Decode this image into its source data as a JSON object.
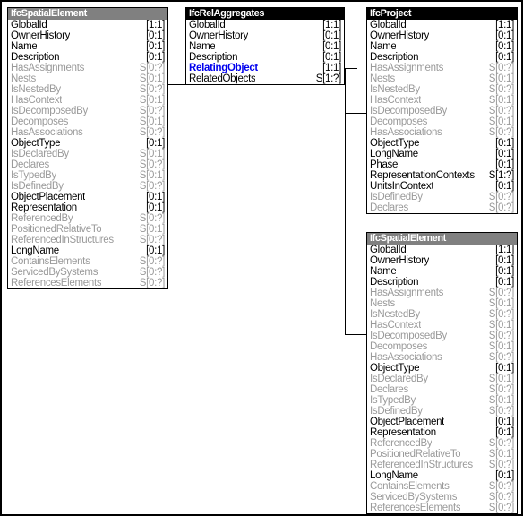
{
  "diagram": {
    "title": "IFC Entity Relationship Diagram",
    "background": "#ffffff",
    "border_color": "#000000",
    "colors": {
      "header_gray": "#808080",
      "header_black": "#000000",
      "direct_attribute": "#000000",
      "inverse_attribute": "#9a9a9a",
      "link_attribute": "#0000ee",
      "connector": "#000000"
    }
  },
  "entities": [
    {
      "id": "ifc-spatial-element-left",
      "name": "IfcSpatialElement",
      "header_style": "gray",
      "attributes": [
        {
          "name": "GlobalId",
          "cardinality": "[1:1]",
          "style": "direct"
        },
        {
          "name": "OwnerHistory",
          "cardinality": "[0:1]",
          "style": "direct"
        },
        {
          "name": "Name",
          "cardinality": "[0:1]",
          "style": "direct"
        },
        {
          "name": "Description",
          "cardinality": "[0:1]",
          "style": "direct"
        },
        {
          "name": "HasAssignments",
          "cardinality": "S[0:?]",
          "style": "inverse"
        },
        {
          "name": "Nests",
          "cardinality": "S[0:1]",
          "style": "inverse"
        },
        {
          "name": "IsNestedBy",
          "cardinality": "S[0:?]",
          "style": "inverse"
        },
        {
          "name": "HasContext",
          "cardinality": "S[0:1]",
          "style": "inverse"
        },
        {
          "name": "IsDecomposedBy",
          "cardinality": "S[0:?]",
          "style": "inverse"
        },
        {
          "name": "Decomposes",
          "cardinality": "S[0:1]",
          "style": "inverse"
        },
        {
          "name": "HasAssociations",
          "cardinality": "S[0:?]",
          "style": "inverse"
        },
        {
          "name": "ObjectType",
          "cardinality": "[0:1]",
          "style": "direct"
        },
        {
          "name": "IsDeclaredBy",
          "cardinality": "S[0:1]",
          "style": "inverse"
        },
        {
          "name": "Declares",
          "cardinality": "S[0:?]",
          "style": "inverse"
        },
        {
          "name": "IsTypedBy",
          "cardinality": "S[0:1]",
          "style": "inverse"
        },
        {
          "name": "IsDefinedBy",
          "cardinality": "S[0:?]",
          "style": "inverse"
        },
        {
          "name": "ObjectPlacement",
          "cardinality": "[0:1]",
          "style": "direct"
        },
        {
          "name": "Representation",
          "cardinality": "[0:1]",
          "style": "direct"
        },
        {
          "name": "ReferencedBy",
          "cardinality": "S[0:?]",
          "style": "inverse"
        },
        {
          "name": "PositionedRelativeTo",
          "cardinality": "S[0:1]",
          "style": "inverse"
        },
        {
          "name": "ReferencedInStructures",
          "cardinality": "S[0:?]",
          "style": "inverse"
        },
        {
          "name": "LongName",
          "cardinality": "[0:1]",
          "style": "direct"
        },
        {
          "name": "ContainsElements",
          "cardinality": "S[0:?]",
          "style": "inverse"
        },
        {
          "name": "ServicedBySystems",
          "cardinality": "S[0:?]",
          "style": "inverse"
        },
        {
          "name": "ReferencesElements",
          "cardinality": "S[0:?]",
          "style": "inverse"
        }
      ]
    },
    {
      "id": "ifc-rel-aggregates",
      "name": "IfcRelAggregates",
      "header_style": "black",
      "attributes": [
        {
          "name": "GlobalId",
          "cardinality": "[1:1]",
          "style": "direct"
        },
        {
          "name": "OwnerHistory",
          "cardinality": "[0:1]",
          "style": "direct"
        },
        {
          "name": "Name",
          "cardinality": "[0:1]",
          "style": "direct"
        },
        {
          "name": "Description",
          "cardinality": "[0:1]",
          "style": "direct"
        },
        {
          "name": "RelatingObject",
          "cardinality": "[1:1]",
          "style": "link"
        },
        {
          "name": "RelatedObjects",
          "cardinality": "S[1:?]",
          "style": "direct"
        }
      ]
    },
    {
      "id": "ifc-project",
      "name": "IfcProject",
      "header_style": "black",
      "attributes": [
        {
          "name": "GlobalId",
          "cardinality": "[1:1]",
          "style": "direct"
        },
        {
          "name": "OwnerHistory",
          "cardinality": "[0:1]",
          "style": "direct"
        },
        {
          "name": "Name",
          "cardinality": "[0:1]",
          "style": "direct"
        },
        {
          "name": "Description",
          "cardinality": "[0:1]",
          "style": "direct"
        },
        {
          "name": "HasAssignments",
          "cardinality": "S[0:?]",
          "style": "inverse"
        },
        {
          "name": "Nests",
          "cardinality": "S[0:1]",
          "style": "inverse"
        },
        {
          "name": "IsNestedBy",
          "cardinality": "S[0:?]",
          "style": "inverse"
        },
        {
          "name": "HasContext",
          "cardinality": "S[0:1]",
          "style": "inverse"
        },
        {
          "name": "IsDecomposedBy",
          "cardinality": "S[0:?]",
          "style": "inverse"
        },
        {
          "name": "Decomposes",
          "cardinality": "S[0:1]",
          "style": "inverse"
        },
        {
          "name": "HasAssociations",
          "cardinality": "S[0:?]",
          "style": "inverse"
        },
        {
          "name": "ObjectType",
          "cardinality": "[0:1]",
          "style": "direct"
        },
        {
          "name": "LongName",
          "cardinality": "[0:1]",
          "style": "direct"
        },
        {
          "name": "Phase",
          "cardinality": "[0:1]",
          "style": "direct"
        },
        {
          "name": "RepresentationContexts",
          "cardinality": "S[1:?]",
          "style": "direct"
        },
        {
          "name": "UnitsInContext",
          "cardinality": "[0:1]",
          "style": "direct"
        },
        {
          "name": "IsDefinedBy",
          "cardinality": "S[0:?]",
          "style": "inverse"
        },
        {
          "name": "Declares",
          "cardinality": "S[0:?]",
          "style": "inverse"
        }
      ]
    },
    {
      "id": "ifc-spatial-element-right",
      "name": "IfcSpatialElement",
      "header_style": "gray",
      "attributes": [
        {
          "name": "GlobalId",
          "cardinality": "[1:1]",
          "style": "direct"
        },
        {
          "name": "OwnerHistory",
          "cardinality": "[0:1]",
          "style": "direct"
        },
        {
          "name": "Name",
          "cardinality": "[0:1]",
          "style": "direct"
        },
        {
          "name": "Description",
          "cardinality": "[0:1]",
          "style": "direct"
        },
        {
          "name": "HasAssignments",
          "cardinality": "S[0:?]",
          "style": "inverse"
        },
        {
          "name": "Nests",
          "cardinality": "S[0:1]",
          "style": "inverse"
        },
        {
          "name": "IsNestedBy",
          "cardinality": "S[0:?]",
          "style": "inverse"
        },
        {
          "name": "HasContext",
          "cardinality": "S[0:1]",
          "style": "inverse"
        },
        {
          "name": "IsDecomposedBy",
          "cardinality": "S[0:?]",
          "style": "inverse"
        },
        {
          "name": "Decomposes",
          "cardinality": "S[0:1]",
          "style": "inverse"
        },
        {
          "name": "HasAssociations",
          "cardinality": "S[0:?]",
          "style": "inverse"
        },
        {
          "name": "ObjectType",
          "cardinality": "[0:1]",
          "style": "direct"
        },
        {
          "name": "IsDeclaredBy",
          "cardinality": "S[0:1]",
          "style": "inverse"
        },
        {
          "name": "Declares",
          "cardinality": "S[0:?]",
          "style": "inverse"
        },
        {
          "name": "IsTypedBy",
          "cardinality": "S[0:1]",
          "style": "inverse"
        },
        {
          "name": "IsDefinedBy",
          "cardinality": "S[0:?]",
          "style": "inverse"
        },
        {
          "name": "ObjectPlacement",
          "cardinality": "[0:1]",
          "style": "direct"
        },
        {
          "name": "Representation",
          "cardinality": "[0:1]",
          "style": "direct"
        },
        {
          "name": "ReferencedBy",
          "cardinality": "S[0:?]",
          "style": "inverse"
        },
        {
          "name": "PositionedRelativeTo",
          "cardinality": "S[0:1]",
          "style": "inverse"
        },
        {
          "name": "ReferencedInStructures",
          "cardinality": "S[0:?]",
          "style": "inverse"
        },
        {
          "name": "LongName",
          "cardinality": "[0:1]",
          "style": "direct"
        },
        {
          "name": "ContainsElements",
          "cardinality": "S[0:?]",
          "style": "inverse"
        },
        {
          "name": "ServicedBySystems",
          "cardinality": "S[0:?]",
          "style": "inverse"
        },
        {
          "name": "ReferencesElements",
          "cardinality": "S[0:?]",
          "style": "inverse"
        }
      ]
    }
  ],
  "connections": [
    {
      "id": "related-objects-to-spatial-element-left",
      "from_entity": "IfcRelAggregates",
      "from_attribute": "RelatedObjects",
      "to_entity": "IfcSpatialElement",
      "to_attribute": "Decomposes"
    },
    {
      "id": "relating-object-to-project",
      "from_entity": "IfcRelAggregates",
      "from_attribute": "RelatingObject",
      "to_entity": "IfcProject",
      "to_attribute": "IsDecomposedBy"
    },
    {
      "id": "relating-object-to-spatial-element-right",
      "from_entity": "IfcRelAggregates",
      "from_attribute": "RelatingObject",
      "to_entity": "IfcSpatialElement",
      "to_attribute": "IsDecomposedBy"
    }
  ]
}
